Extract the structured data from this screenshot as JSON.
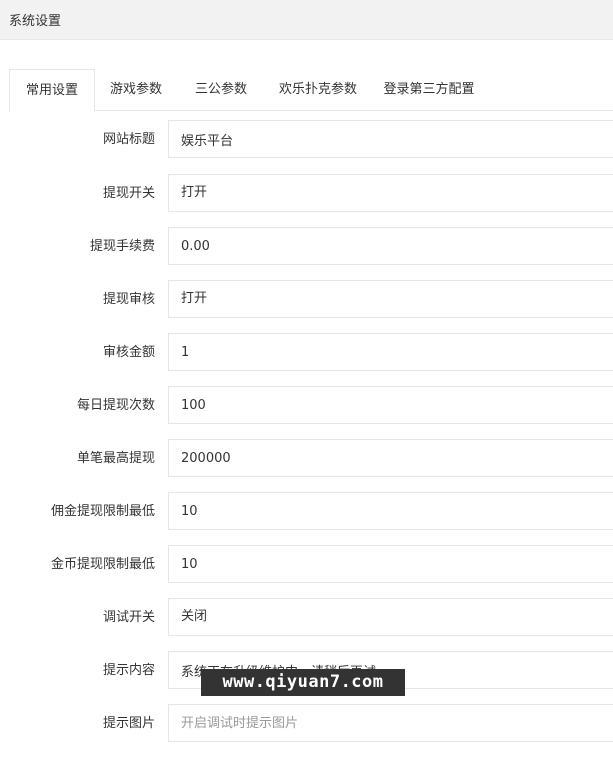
{
  "header": {
    "title": "系统设置"
  },
  "tabs": [
    {
      "label": "常用设置",
      "active": true
    },
    {
      "label": "游戏参数",
      "active": false
    },
    {
      "label": "三公参数",
      "active": false
    },
    {
      "label": "欢乐扑克参数",
      "active": false
    },
    {
      "label": "登录第三方配置",
      "active": false
    }
  ],
  "form": {
    "site_title": {
      "label": "网站标题",
      "value": "娱乐平台"
    },
    "withdraw_switch": {
      "label": "提现开关",
      "value": "打开"
    },
    "withdraw_fee": {
      "label": "提现手续费",
      "value": "0.00"
    },
    "withdraw_audit": {
      "label": "提现审核",
      "value": "打开"
    },
    "audit_amount": {
      "label": "审核金额",
      "value": "1"
    },
    "daily_withdraw_count": {
      "label": "每日提现次数",
      "value": "100"
    },
    "max_single_withdraw": {
      "label": "单笔最高提现",
      "value": "200000"
    },
    "commission_min": {
      "label": "佣金提现限制最低",
      "value": "10"
    },
    "coin_min": {
      "label": "金币提现限制最低",
      "value": "10"
    },
    "debug_switch": {
      "label": "调试开关",
      "value": "关闭"
    },
    "notice_content": {
      "label": "提示内容",
      "value": "系统正在升级维护中，请稍后再试"
    },
    "notice_image": {
      "label": "提示图片",
      "placeholder": "开启调试时提示图片"
    }
  },
  "watermark": {
    "text": "www.qiyuan7.com"
  }
}
